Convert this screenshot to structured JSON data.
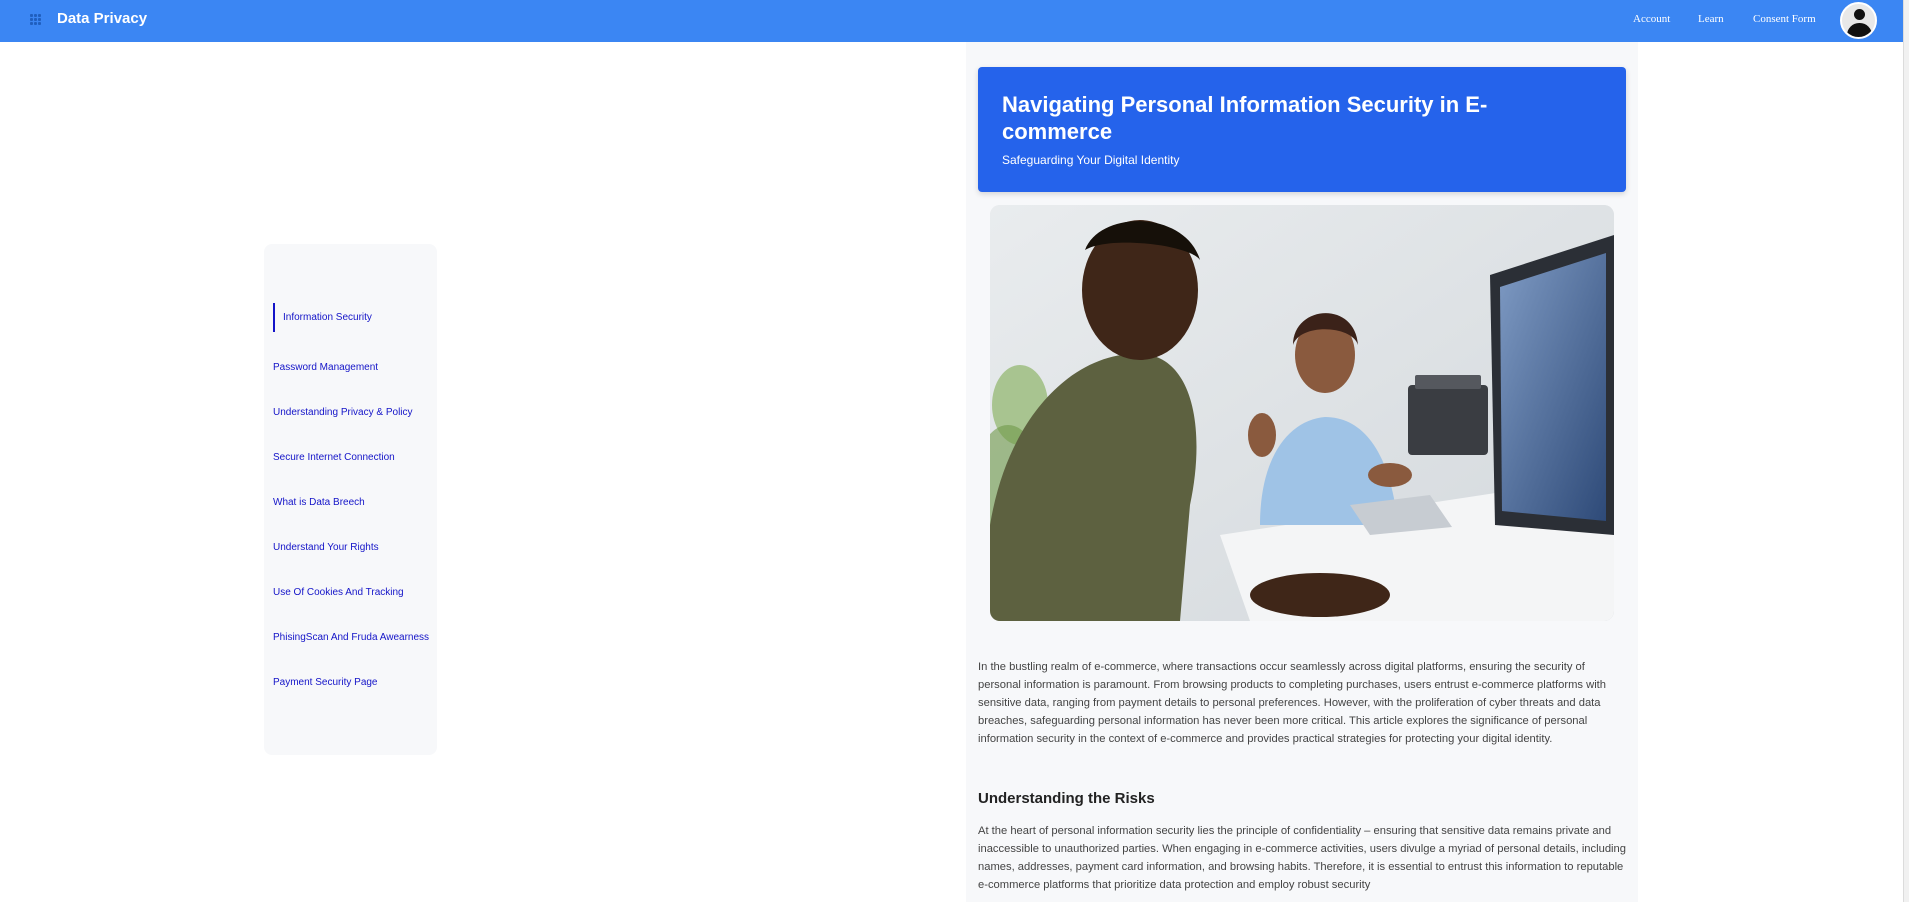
{
  "header": {
    "brand": "Data Privacy",
    "nav": [
      "Account",
      "Learn",
      "Consent Form"
    ]
  },
  "sidebar": {
    "items": [
      {
        "label": "Information Security"
      },
      {
        "label": "Password Management"
      },
      {
        "label": "Understanding Privacy & Policy"
      },
      {
        "label": "Secure Internet Connection"
      },
      {
        "label": "What is Data Breech"
      },
      {
        "label": "Understand Your Rights"
      },
      {
        "label": "Use Of Cookies And Tracking"
      },
      {
        "label": "PhisingScan And Fruda Awearness"
      },
      {
        "label": "Payment Security Page"
      }
    ]
  },
  "article": {
    "title": "Navigating Personal Information Security in E-commerce",
    "subtitle": "Safeguarding Your Digital Identity",
    "intro": "In the bustling realm of e-commerce, where transactions occur seamlessly across digital platforms, ensuring the security of personal information is paramount. From browsing products to completing purchases, users entrust e-commerce platforms with sensitive data, ranging from payment details to personal preferences. However, with the proliferation of cyber threats and data breaches, safeguarding personal information has never been more critical. This article explores the significance of personal information security in the context of e-commerce and provides practical strategies for protecting your digital identity.",
    "section_heading": "Understanding the Risks",
    "section_text": "At the heart of personal information security lies the principle of confidentiality – ensuring that sensitive data remains private and inaccessible to unauthorized parties. When engaging in e-commerce activities, users divulge a myriad of personal details, including names, addresses, payment card information, and browsing habits. Therefore, it is essential to entrust this information to reputable e-commerce platforms that prioritize data protection and employ robust security"
  },
  "colors": {
    "topbar": "#3b86f3",
    "hero": "#2563eb",
    "link": "#1414c8"
  }
}
